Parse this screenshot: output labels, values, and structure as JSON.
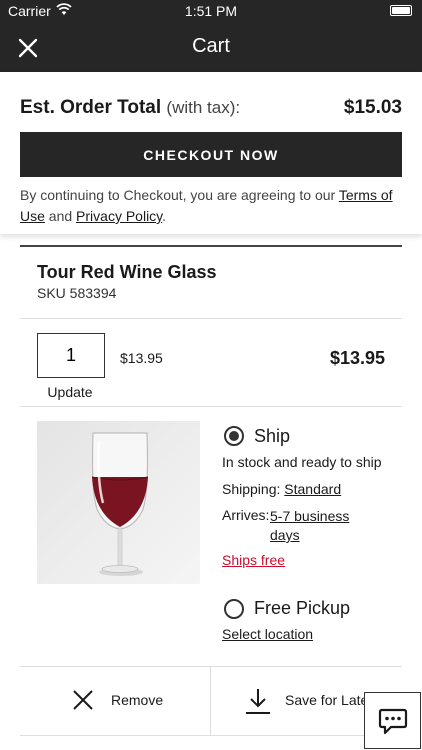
{
  "status_bar": {
    "carrier": "Carrier",
    "time": "1:51 PM"
  },
  "nav": {
    "title": "Cart",
    "close_icon": "close-icon"
  },
  "summary": {
    "label": "Est. Order Total",
    "label_sub": "(with tax):",
    "total": "$15.03",
    "checkout_label": "CHECKOUT NOW",
    "terms_prefix": "By continuing to Checkout, you are agreeing to our ",
    "terms_link": "Terms of Use",
    "terms_and": " and ",
    "privacy_link": "Privacy Policy",
    "terms_end": "."
  },
  "item": {
    "name": "Tour Red Wine Glass",
    "sku": "SKU 583394",
    "quantity": "1",
    "unit_price": "$13.95",
    "line_total": "$13.95",
    "update_label": "Update",
    "image_icon": "red-wine-glass-image"
  },
  "fulfillment": {
    "ship": {
      "label": "Ship",
      "selected": true,
      "stock": "In stock and ready to ship",
      "shipping_label": "Shipping:",
      "shipping_value": "Standard",
      "arrives_label": "Arrives:",
      "arrives_value": "5-7 business days",
      "ships_free": "Ships free"
    },
    "pickup": {
      "label": "Free Pickup",
      "selected": false,
      "select_location": "Select location"
    }
  },
  "actions": {
    "remove_label": "Remove",
    "save_label": "Save for Later"
  },
  "colors": {
    "nav_bg": "#262626",
    "accent_red": "#c8102e",
    "text": "#1a1a1a"
  },
  "chat_icon": "chat-bubble-icon"
}
